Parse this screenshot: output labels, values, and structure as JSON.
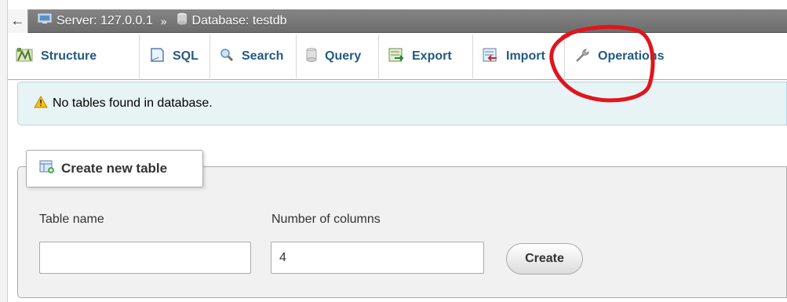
{
  "breadcrumb": {
    "back_icon": "back-arrow-icon",
    "server_label": "Server: 127.0.0.1",
    "separator": "»",
    "database_label": "Database: testdb"
  },
  "tabs": [
    {
      "label": "Structure",
      "icon": "structure-icon"
    },
    {
      "label": "SQL",
      "icon": "sql-icon"
    },
    {
      "label": "Search",
      "icon": "search-icon"
    },
    {
      "label": "Query",
      "icon": "query-icon"
    },
    {
      "label": "Export",
      "icon": "export-icon"
    },
    {
      "label": "Import",
      "icon": "import-icon"
    },
    {
      "label": "Operations",
      "icon": "wrench-icon"
    }
  ],
  "notice": {
    "icon": "warning-icon",
    "text": "No tables found in database."
  },
  "create_table": {
    "legend": "Create new table",
    "table_name_label": "Table name",
    "table_name_value": "",
    "columns_label": "Number of columns",
    "columns_value": "4",
    "create_button": "Create"
  },
  "colors": {
    "tab_text": "#235a81",
    "breadcrumb_bg": "#777777",
    "notice_bg": "#e8f3f6",
    "annotation": "#e0151b"
  }
}
